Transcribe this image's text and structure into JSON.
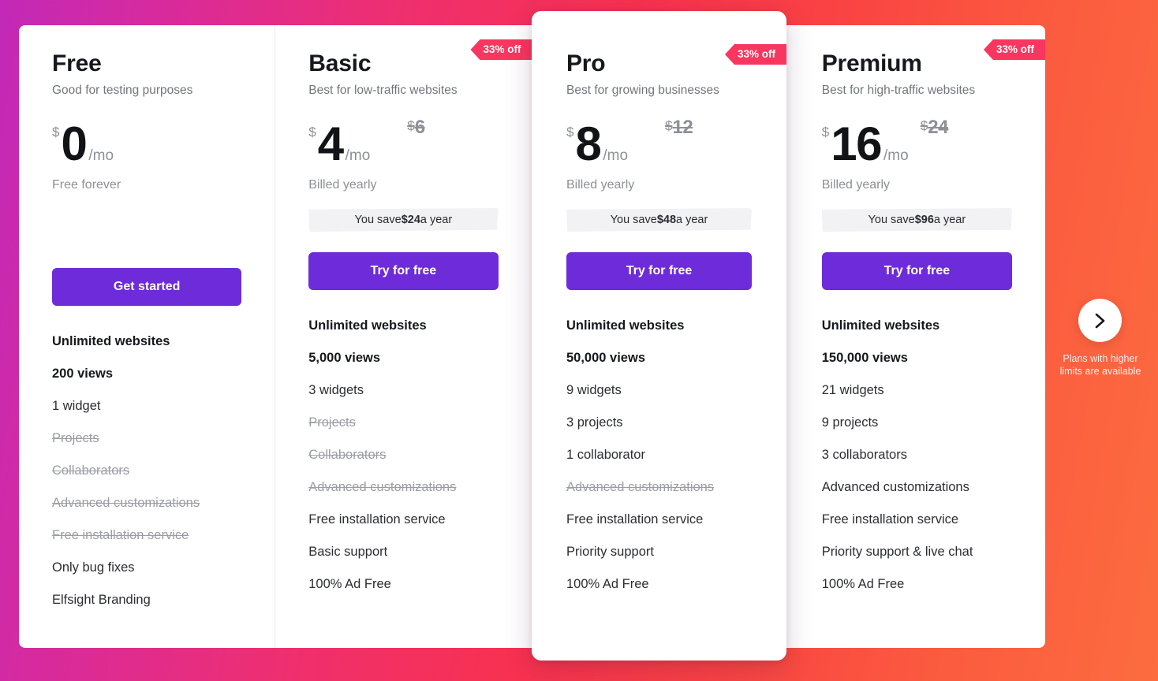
{
  "theme": {
    "gradient_left": "#c229b8",
    "gradient_mid": "#f8314f",
    "gradient_right": "#fc6c3f",
    "cta_purple": "#6e2bda",
    "badge_pink": "#f9365f",
    "panel_bg": "#ffffff"
  },
  "plans": [
    {
      "name": "Free",
      "tagline": "Good for testing purposes",
      "badge": null,
      "currency": "$",
      "amount": "0",
      "per": "/mo",
      "old_currency": "",
      "old_amount": "",
      "billing": "Free forever",
      "save_prefix": "",
      "save_amount": "",
      "save_suffix": "",
      "cta": "Get started",
      "features": [
        {
          "text": "Unlimited websites",
          "style": "strong"
        },
        {
          "text": "200 views",
          "style": "strong"
        },
        {
          "text": "1 widget",
          "style": "normal"
        },
        {
          "text": "Projects",
          "style": "off"
        },
        {
          "text": "Collaborators",
          "style": "off"
        },
        {
          "text": "Advanced customizations",
          "style": "off"
        },
        {
          "text": "Free installation service",
          "style": "off"
        },
        {
          "text": "Only bug fixes",
          "style": "normal"
        },
        {
          "text": "Elfsight Branding",
          "style": "normal"
        }
      ]
    },
    {
      "name": "Basic",
      "tagline": "Best for low-traffic websites",
      "badge": "33% off",
      "currency": "$",
      "amount": "4",
      "per": "/mo",
      "old_currency": "$",
      "old_amount": "6",
      "billing": "Billed yearly",
      "save_prefix": "You save ",
      "save_amount": "$24",
      "save_suffix": " a year",
      "cta": "Try for free",
      "features": [
        {
          "text": "Unlimited websites",
          "style": "strong"
        },
        {
          "text": "5,000 views",
          "style": "strong"
        },
        {
          "text": "3 widgets",
          "style": "normal"
        },
        {
          "text": "Projects",
          "style": "off"
        },
        {
          "text": "Collaborators",
          "style": "off"
        },
        {
          "text": "Advanced customizations",
          "style": "off"
        },
        {
          "text": "Free installation service",
          "style": "normal"
        },
        {
          "text": "Basic support",
          "style": "normal"
        },
        {
          "text": "100% Ad Free",
          "style": "normal"
        }
      ]
    },
    {
      "name": "Pro",
      "tagline": "Best for growing businesses",
      "badge": "33% off",
      "currency": "$",
      "amount": "8",
      "per": "/mo",
      "old_currency": "$",
      "old_amount": "12",
      "billing": "Billed yearly",
      "save_prefix": "You save ",
      "save_amount": "$48",
      "save_suffix": " a year",
      "cta": "Try for free",
      "features": [
        {
          "text": "Unlimited websites",
          "style": "strong"
        },
        {
          "text": "50,000 views",
          "style": "strong"
        },
        {
          "text": "9 widgets",
          "style": "normal"
        },
        {
          "text": "3 projects",
          "style": "normal"
        },
        {
          "text": "1 collaborator",
          "style": "normal"
        },
        {
          "text": "Advanced customizations",
          "style": "off"
        },
        {
          "text": "Free installation service",
          "style": "normal"
        },
        {
          "text": "Priority support",
          "style": "normal"
        },
        {
          "text": "100% Ad Free",
          "style": "normal"
        }
      ]
    },
    {
      "name": "Premium",
      "tagline": "Best for high-traffic websites",
      "badge": "33% off",
      "currency": "$",
      "amount": "16",
      "per": "/mo",
      "old_currency": "$",
      "old_amount": "24",
      "billing": "Billed yearly",
      "save_prefix": "You save ",
      "save_amount": "$96",
      "save_suffix": " a year",
      "cta": "Try for free",
      "features": [
        {
          "text": "Unlimited websites",
          "style": "strong"
        },
        {
          "text": "150,000 views",
          "style": "strong"
        },
        {
          "text": "21 widgets",
          "style": "normal"
        },
        {
          "text": "9 projects",
          "style": "normal"
        },
        {
          "text": "3 collaborators",
          "style": "normal"
        },
        {
          "text": "Advanced customizations",
          "style": "normal"
        },
        {
          "text": "Free installation service",
          "style": "normal"
        },
        {
          "text": "Priority support & live chat",
          "style": "normal"
        },
        {
          "text": "100% Ad Free",
          "style": "normal"
        }
      ]
    }
  ],
  "next_control": {
    "icon": "chevron-right-icon",
    "caption_line1": "Plans with higher",
    "caption_line2": "limits are available"
  }
}
